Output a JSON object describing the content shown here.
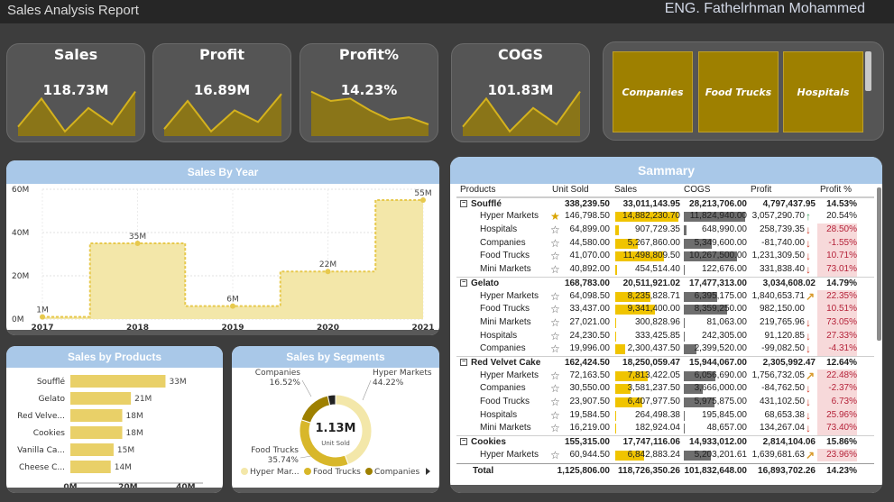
{
  "header": {
    "title": "Sales Analysis Report",
    "author": "ENG. Fathelrhman Mohammed"
  },
  "colors": {
    "gold": "#9e8000",
    "area": "#f3e7a9",
    "dash": "#e7c94e",
    "bar": "#e9d068",
    "header": "#a9c8e8",
    "panel_bottom": "#595959",
    "up": "#3aa35c",
    "down": "#d23c2b"
  },
  "kpis": [
    {
      "label": "Sales",
      "value": "118.73M",
      "spark": [
        0.2,
        0.8,
        0.1,
        0.6,
        0.25,
        0.95
      ]
    },
    {
      "label": "Profit",
      "value": "16.89M",
      "spark": [
        0.15,
        0.75,
        0.1,
        0.55,
        0.3,
        0.9
      ]
    },
    {
      "label": "Profit%",
      "value": "14.23%",
      "spark": [
        0.95,
        0.75,
        0.8,
        0.55,
        0.35,
        0.4,
        0.25
      ]
    },
    {
      "label": "COGS",
      "value": "101.83M",
      "spark": [
        0.2,
        0.8,
        0.1,
        0.6,
        0.25,
        0.95
      ]
    }
  ],
  "slicer": {
    "items": [
      "Companies",
      "Food Trucks",
      "Hospitals"
    ]
  },
  "sales_by_year": {
    "title": "Sales By Year",
    "y_ticks": [
      "60M",
      "40M",
      "20M",
      "0M"
    ],
    "chart_data": {
      "type": "area",
      "title": "Sales By Year",
      "categories": [
        "2017",
        "2018",
        "2019",
        "2020",
        "2021"
      ],
      "values": [
        1,
        35,
        6,
        22,
        55
      ],
      "labels": [
        "1M",
        "35M",
        "6M",
        "22M",
        "55M"
      ],
      "ylim": [
        0,
        60
      ],
      "grid": true
    }
  },
  "sales_by_products": {
    "title": "Sales by Products",
    "x_ticks": [
      "0M",
      "20M",
      "40M"
    ],
    "chart_data": {
      "type": "bar",
      "title": "Sales by Products",
      "categories": [
        "Soufflé",
        "Gelato",
        "Red Velve...",
        "Cookies",
        "Vanilla Ca...",
        "Cheese C..."
      ],
      "values": [
        33,
        21,
        18,
        18,
        15,
        14
      ],
      "labels": [
        "33M",
        "21M",
        "18M",
        "18M",
        "15M",
        "14M"
      ],
      "xlim": [
        0,
        46
      ]
    }
  },
  "sales_by_segments": {
    "title": "Sales by Segments",
    "center_value": "1.13M",
    "center_label": "Unit Sold",
    "legend": [
      "Hyper Mar...",
      "Food Trucks",
      "Companies"
    ],
    "chart_data": {
      "type": "pie",
      "title": "Sales by Segments",
      "slices": [
        {
          "name": "Hyper Markets",
          "value": 44.22,
          "label": "44.22%",
          "color": "#f3e7a9"
        },
        {
          "name": "Food Trucks",
          "value": 35.74,
          "label": "35.74%",
          "color": "#d8b72a"
        },
        {
          "name": "Companies",
          "value": 16.52,
          "label": "16.52%",
          "color": "#9e8000"
        },
        {
          "name": "Other",
          "value": 3.52,
          "label": "",
          "color": "#222222"
        }
      ]
    },
    "callouts": {
      "companies": "Companies",
      "companies_pct": "16.52%",
      "hyper": "Hyper Markets",
      "hyper_pct": "44.22%",
      "food": "Food Trucks",
      "food_pct": "35.74%"
    }
  },
  "summary": {
    "title": "Sammary",
    "columns": [
      "Products",
      "Unit Sold",
      "Sales",
      "COGS",
      "Profit",
      "Profit %"
    ],
    "rows": [
      {
        "type": "group",
        "name": "Soufflé",
        "units": "338,239.50",
        "sales": "33,011,143.95",
        "cogs": "28,213,706.00",
        "profit": "4,797,437.95",
        "pct": "14.53%"
      },
      {
        "type": "item",
        "name": "Hyper Markets",
        "units": "146,798.50",
        "sales": "14,882,230.70",
        "cogs": "11,824,940.00",
        "profit": "3,057,290.70",
        "pct": "20.54%",
        "star": "gold",
        "arrow": "up",
        "sf": 1.0,
        "cf": 1.0,
        "neg": false
      },
      {
        "type": "item",
        "name": "Hospitals",
        "units": "64,899.00",
        "sales": "907,729.35",
        "cogs": "648,990.00",
        "profit": "258,739.35",
        "pct": "28.50%",
        "star": "none",
        "arrow": "down",
        "sf": 0.06,
        "cf": 0.05,
        "neg": true
      },
      {
        "type": "item",
        "name": "Companies",
        "units": "44,580.00",
        "sales": "5,267,860.00",
        "cogs": "5,349,600.00",
        "profit": "-81,740.00",
        "pct": "-1.55%",
        "star": "none",
        "arrow": "down",
        "sf": 0.35,
        "cf": 0.45,
        "neg": true
      },
      {
        "type": "item",
        "name": "Food Trucks",
        "units": "41,070.00",
        "sales": "11,498,809.50",
        "cogs": "10,267,500.00",
        "profit": "1,231,309.50",
        "pct": "10.71%",
        "star": "none",
        "arrow": "down",
        "sf": 0.77,
        "cf": 0.87,
        "neg": true
      },
      {
        "type": "item",
        "name": "Mini Markets",
        "units": "40,892.00",
        "sales": "454,514.40",
        "cogs": "122,676.00",
        "profit": "331,838.40",
        "pct": "73.01%",
        "star": "none",
        "arrow": "down",
        "sf": 0.03,
        "cf": 0.01,
        "neg": true
      },
      {
        "type": "group",
        "name": "Gelato",
        "units": "168,783.00",
        "sales": "20,511,921.02",
        "cogs": "17,477,313.00",
        "profit": "3,034,608.02",
        "pct": "14.79%"
      },
      {
        "type": "item",
        "name": "Hyper Markets",
        "units": "64,098.50",
        "sales": "8,235,828.71",
        "cogs": "6,395,175.00",
        "profit": "1,840,653.71",
        "pct": "22.35%",
        "star": "half",
        "arrow": "upright",
        "sf": 0.55,
        "cf": 0.54,
        "neg": true
      },
      {
        "type": "item",
        "name": "Food Trucks",
        "units": "33,437.00",
        "sales": "9,341,400.00",
        "cogs": "8,359,250.00",
        "profit": "982,150.00",
        "pct": "10.51%",
        "star": "none",
        "arrow": "none",
        "sf": 0.63,
        "cf": 0.71,
        "neg": true
      },
      {
        "type": "item",
        "name": "Mini Markets",
        "units": "27,021.00",
        "sales": "300,828.96",
        "cogs": "81,063.00",
        "profit": "219,765.96",
        "pct": "73.05%",
        "star": "none",
        "arrow": "down",
        "sf": 0.02,
        "cf": 0.01,
        "neg": true
      },
      {
        "type": "item",
        "name": "Hospitals",
        "units": "24,230.50",
        "sales": "333,425.85",
        "cogs": "242,305.00",
        "profit": "91,120.85",
        "pct": "27.33%",
        "star": "none",
        "arrow": "down",
        "sf": 0.02,
        "cf": 0.02,
        "neg": true
      },
      {
        "type": "item",
        "name": "Companies",
        "units": "19,996.00",
        "sales": "2,300,437.50",
        "cogs": "2,399,520.00",
        "profit": "-99,082.50",
        "pct": "-4.31%",
        "star": "none",
        "arrow": "down",
        "sf": 0.15,
        "cf": 0.2,
        "neg": true
      },
      {
        "type": "group",
        "name": "Red Velvet Cake",
        "units": "162,424.50",
        "sales": "18,250,059.47",
        "cogs": "15,944,067.00",
        "profit": "2,305,992.47",
        "pct": "12.64%"
      },
      {
        "type": "item",
        "name": "Hyper Markets",
        "units": "72,163.50",
        "sales": "7,813,422.05",
        "cogs": "6,056,690.00",
        "profit": "1,756,732.05",
        "pct": "22.48%",
        "star": "half",
        "arrow": "upright",
        "sf": 0.52,
        "cf": 0.51,
        "neg": true
      },
      {
        "type": "item",
        "name": "Companies",
        "units": "30,550.00",
        "sales": "3,581,237.50",
        "cogs": "3,666,000.00",
        "profit": "-84,762.50",
        "pct": "-2.37%",
        "star": "none",
        "arrow": "down",
        "sf": 0.24,
        "cf": 0.31,
        "neg": true
      },
      {
        "type": "item",
        "name": "Food Trucks",
        "units": "23,907.50",
        "sales": "6,407,977.50",
        "cogs": "5,975,875.00",
        "profit": "431,102.50",
        "pct": "6.73%",
        "star": "none",
        "arrow": "down",
        "sf": 0.43,
        "cf": 0.5,
        "neg": true
      },
      {
        "type": "item",
        "name": "Hospitals",
        "units": "19,584.50",
        "sales": "264,498.38",
        "cogs": "195,845.00",
        "profit": "68,653.38",
        "pct": "25.96%",
        "star": "none",
        "arrow": "down",
        "sf": 0.02,
        "cf": 0.02,
        "neg": true
      },
      {
        "type": "item",
        "name": "Mini Markets",
        "units": "16,219.00",
        "sales": "182,924.04",
        "cogs": "48,657.00",
        "profit": "134,267.04",
        "pct": "73.40%",
        "star": "none",
        "arrow": "down",
        "sf": 0.01,
        "cf": 0.01,
        "neg": true
      },
      {
        "type": "group",
        "name": "Cookies",
        "units": "155,315.00",
        "sales": "17,747,116.06",
        "cogs": "14,933,012.00",
        "profit": "2,814,104.06",
        "pct": "15.86%"
      },
      {
        "type": "item",
        "name": "Hyper Markets",
        "units": "60,944.50",
        "sales": "6,842,883.24",
        "cogs": "5,203,201.61",
        "profit": "1,639,681.63",
        "pct": "23.96%",
        "star": "half",
        "arrow": "upright",
        "sf": 0.46,
        "cf": 0.44,
        "neg": true
      }
    ],
    "total": {
      "name": "Total",
      "units": "1,125,806.00",
      "sales": "118,726,350.26",
      "cogs": "101,832,648.00",
      "profit": "16,893,702.26",
      "pct": "14.23%"
    }
  }
}
